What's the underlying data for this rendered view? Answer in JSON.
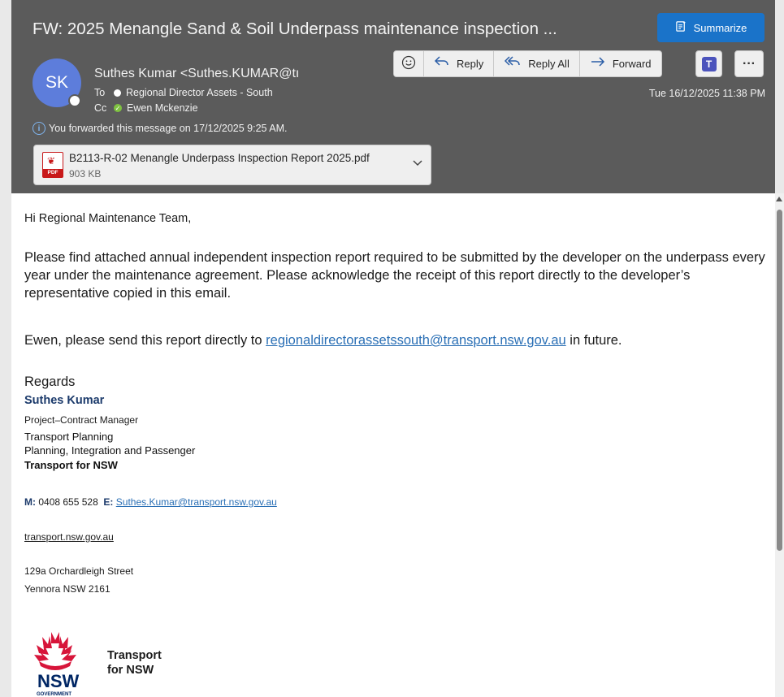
{
  "header": {
    "subject": "FW: 2025 Menangle Sand & Soil  Underpass maintenance inspection ...",
    "summarize_label": "Summarize",
    "avatar_initials": "SK",
    "sender": "Suthes Kumar <Suthes.KUMAR@tı",
    "to_key": "To",
    "to_value": "Regional Director Assets - South",
    "cc_key": "Cc",
    "cc_value": "Ewen Mckenzie",
    "timestamp": "Tue 16/12/2025 11:38 PM",
    "forwarded_notice": "You forwarded this message on 17/12/2025 9:25 AM."
  },
  "toolbar": {
    "reply_label": "Reply",
    "reply_all_label": "Reply All",
    "forward_label": "Forward"
  },
  "attachment": {
    "name": "B2113-R-02 Menangle Underpass Inspection Report 2025.pdf",
    "size": "903 KB",
    "type_label": "PDF"
  },
  "body": {
    "greeting": "Hi Regional Maintenance Team,",
    "para1": "Please find attached annual independent inspection report required to be submitted by the developer on the underpass every year under the maintenance agreement. Please acknowledge the receipt of this report directly to the developer’s representative copied in this email.",
    "para2_prefix": "Ewen, please send this report directly to ",
    "para2_link": "regionaldirectorassetssouth@transport.nsw.gov.au",
    "para2_suffix": " in future.",
    "regards": "Regards"
  },
  "signature": {
    "name": "Suthes Kumar",
    "title": "Project–Contract Manager",
    "dept1": "Transport Planning",
    "dept2": "Planning, Integration and Passenger",
    "org": "Transport for NSW",
    "mobile_key": "M:",
    "mobile": "0408 655 528",
    "email_key": "E:",
    "email": "Suthes.Kumar@transport.nsw.gov.au",
    "website": "transport.nsw.gov.au",
    "address1": "129a Orchardleigh Street",
    "address2": "Yennora NSW 2161",
    "logo_line1": "Transport",
    "logo_line2": "for NSW",
    "logo_mark": "NSW",
    "logo_sub": "GOVERNMENT"
  },
  "colors": {
    "header_bg": "#5b5b5b",
    "accent": "#1a73c9",
    "link": "#2a6fb5",
    "signature_name": "#1b3a6b",
    "waratah_red": "#d7153a"
  }
}
